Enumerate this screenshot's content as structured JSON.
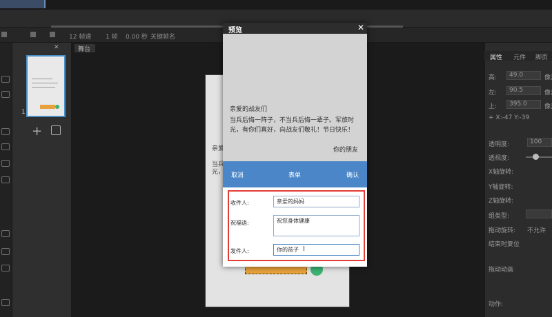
{
  "timeline": {
    "fps": "12 帧速",
    "frame": "1 帧",
    "time": "0.00 秒",
    "keyframe_name": "关键帧名"
  },
  "slides": {
    "number": "1"
  },
  "stage": {
    "tab": "舞台",
    "canvas_text1": "亲爱",
    "canvas_text2": "当兵",
    "canvas_text3": "光，"
  },
  "properties": {
    "tabs": [
      "属性",
      "元件",
      "脚页"
    ],
    "rows": [
      {
        "label": "高:",
        "value": "49.0",
        "unit": "像素"
      },
      {
        "label": "左:",
        "value": "90.5",
        "unit": "像素"
      },
      {
        "label": "上:",
        "value": "395.0",
        "unit": "像素"
      }
    ],
    "coords": "+ X:-47   Y:-39",
    "opacity_label": "透明度:",
    "opacity_value": "100",
    "transparency_label": "透视度:",
    "x_rotate": "X轴旋转:",
    "y_rotate": "Y轴旋转:",
    "z_rotate": "Z轴旋转:",
    "group_type": "组类型:",
    "drag_rotate": "拖动旋转:",
    "drag_rotate_value": "不允许",
    "reset_label": "结束时复位",
    "drag_anim": "拖动动画",
    "action": "动作:"
  },
  "modal": {
    "title": "预览",
    "close": "✕",
    "greeting": "亲爱的战友们",
    "body": "当兵后悔一阵子，不当兵后悔一辈子。军旅时光，有你们真好，向战友们敬礼！节日快乐！",
    "sign": "你的朋友",
    "form_bar": {
      "cancel": "取消",
      "title": "表单",
      "confirm": "确认"
    },
    "form": {
      "recipient_label": "收件人:",
      "recipient_value": "亲爱的妈妈",
      "wish_label": "祝福语:",
      "wish_value": "祝您身体健康",
      "sender_label": "发件人:",
      "sender_value": "你的孩子"
    }
  }
}
